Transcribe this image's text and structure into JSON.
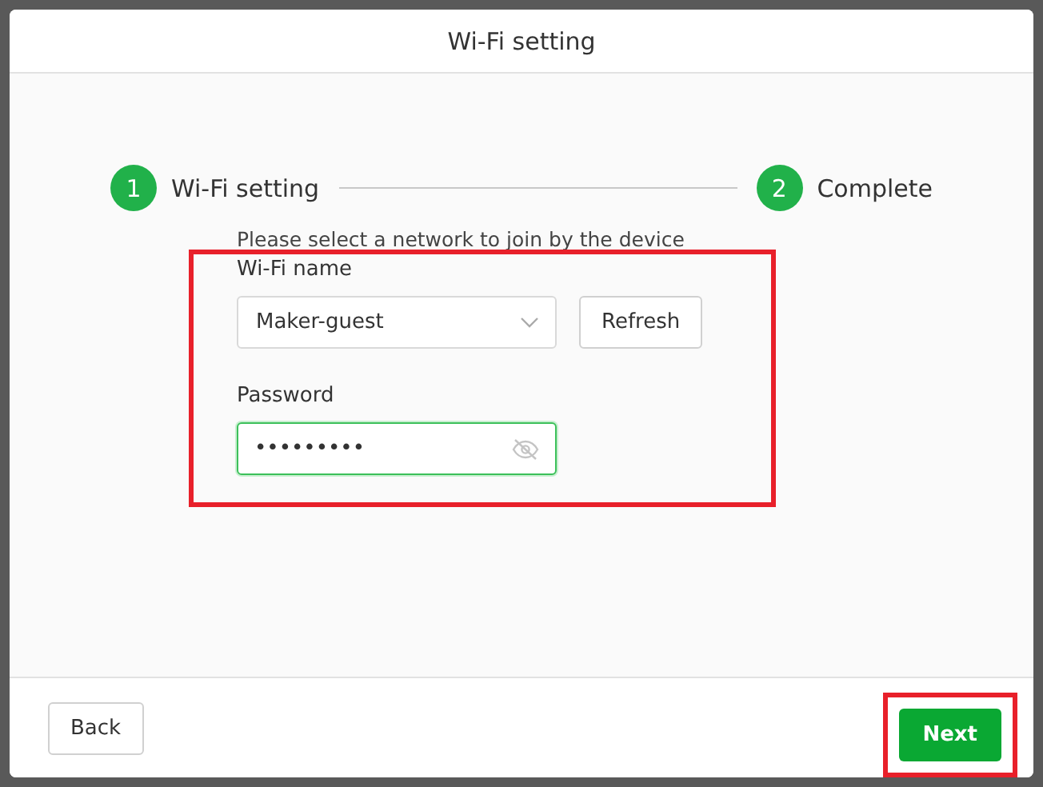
{
  "window": {
    "title": "Wi-Fi setting"
  },
  "steps": [
    {
      "number": "1",
      "label": "Wi-Fi setting"
    },
    {
      "number": "2",
      "label": "Complete"
    }
  ],
  "instruction": "Please select a network to join by the device",
  "form": {
    "highlighted": true,
    "network": {
      "label": "Wi-Fi name",
      "value": "Maker-guest",
      "button": "Refresh"
    },
    "password": {
      "label": "Password",
      "value": "•••••••••",
      "focused": true
    }
  },
  "footer": {
    "back": "Back",
    "next": {
      "label": "Next",
      "highlighted": true
    }
  }
}
